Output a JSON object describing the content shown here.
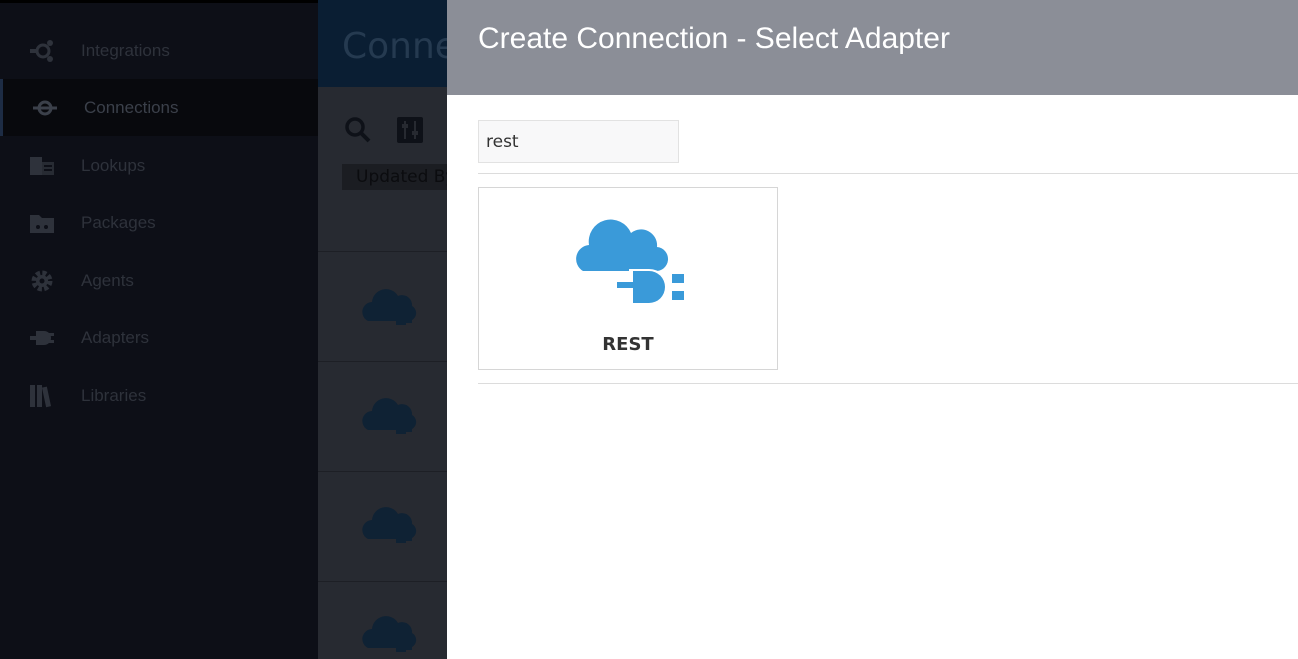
{
  "sidebar": {
    "items": [
      {
        "label": "Integrations",
        "icon": "integrations-icon",
        "active": false
      },
      {
        "label": "Connections",
        "icon": "connections-icon",
        "active": true
      },
      {
        "label": "Lookups",
        "icon": "lookups-icon",
        "active": false
      },
      {
        "label": "Packages",
        "icon": "packages-icon",
        "active": false
      },
      {
        "label": "Agents",
        "icon": "gear-icon",
        "active": false
      },
      {
        "label": "Adapters",
        "icon": "plug-icon",
        "active": false
      },
      {
        "label": "Libraries",
        "icon": "books-icon",
        "active": false
      }
    ]
  },
  "page": {
    "title": "Connections",
    "filter_chip": "Updated By"
  },
  "dialog": {
    "title": "Create Connection - Select Adapter",
    "search": {
      "value": "rest"
    },
    "adapters": [
      {
        "name": "REST",
        "icon": "cloud-plug-icon"
      }
    ]
  },
  "colors": {
    "overlay_sidebar": "#0d0f17",
    "dialog_header": "#8b8e97",
    "adapter_blue": "#3a9ad9",
    "dim_blue": "#0f2234"
  }
}
